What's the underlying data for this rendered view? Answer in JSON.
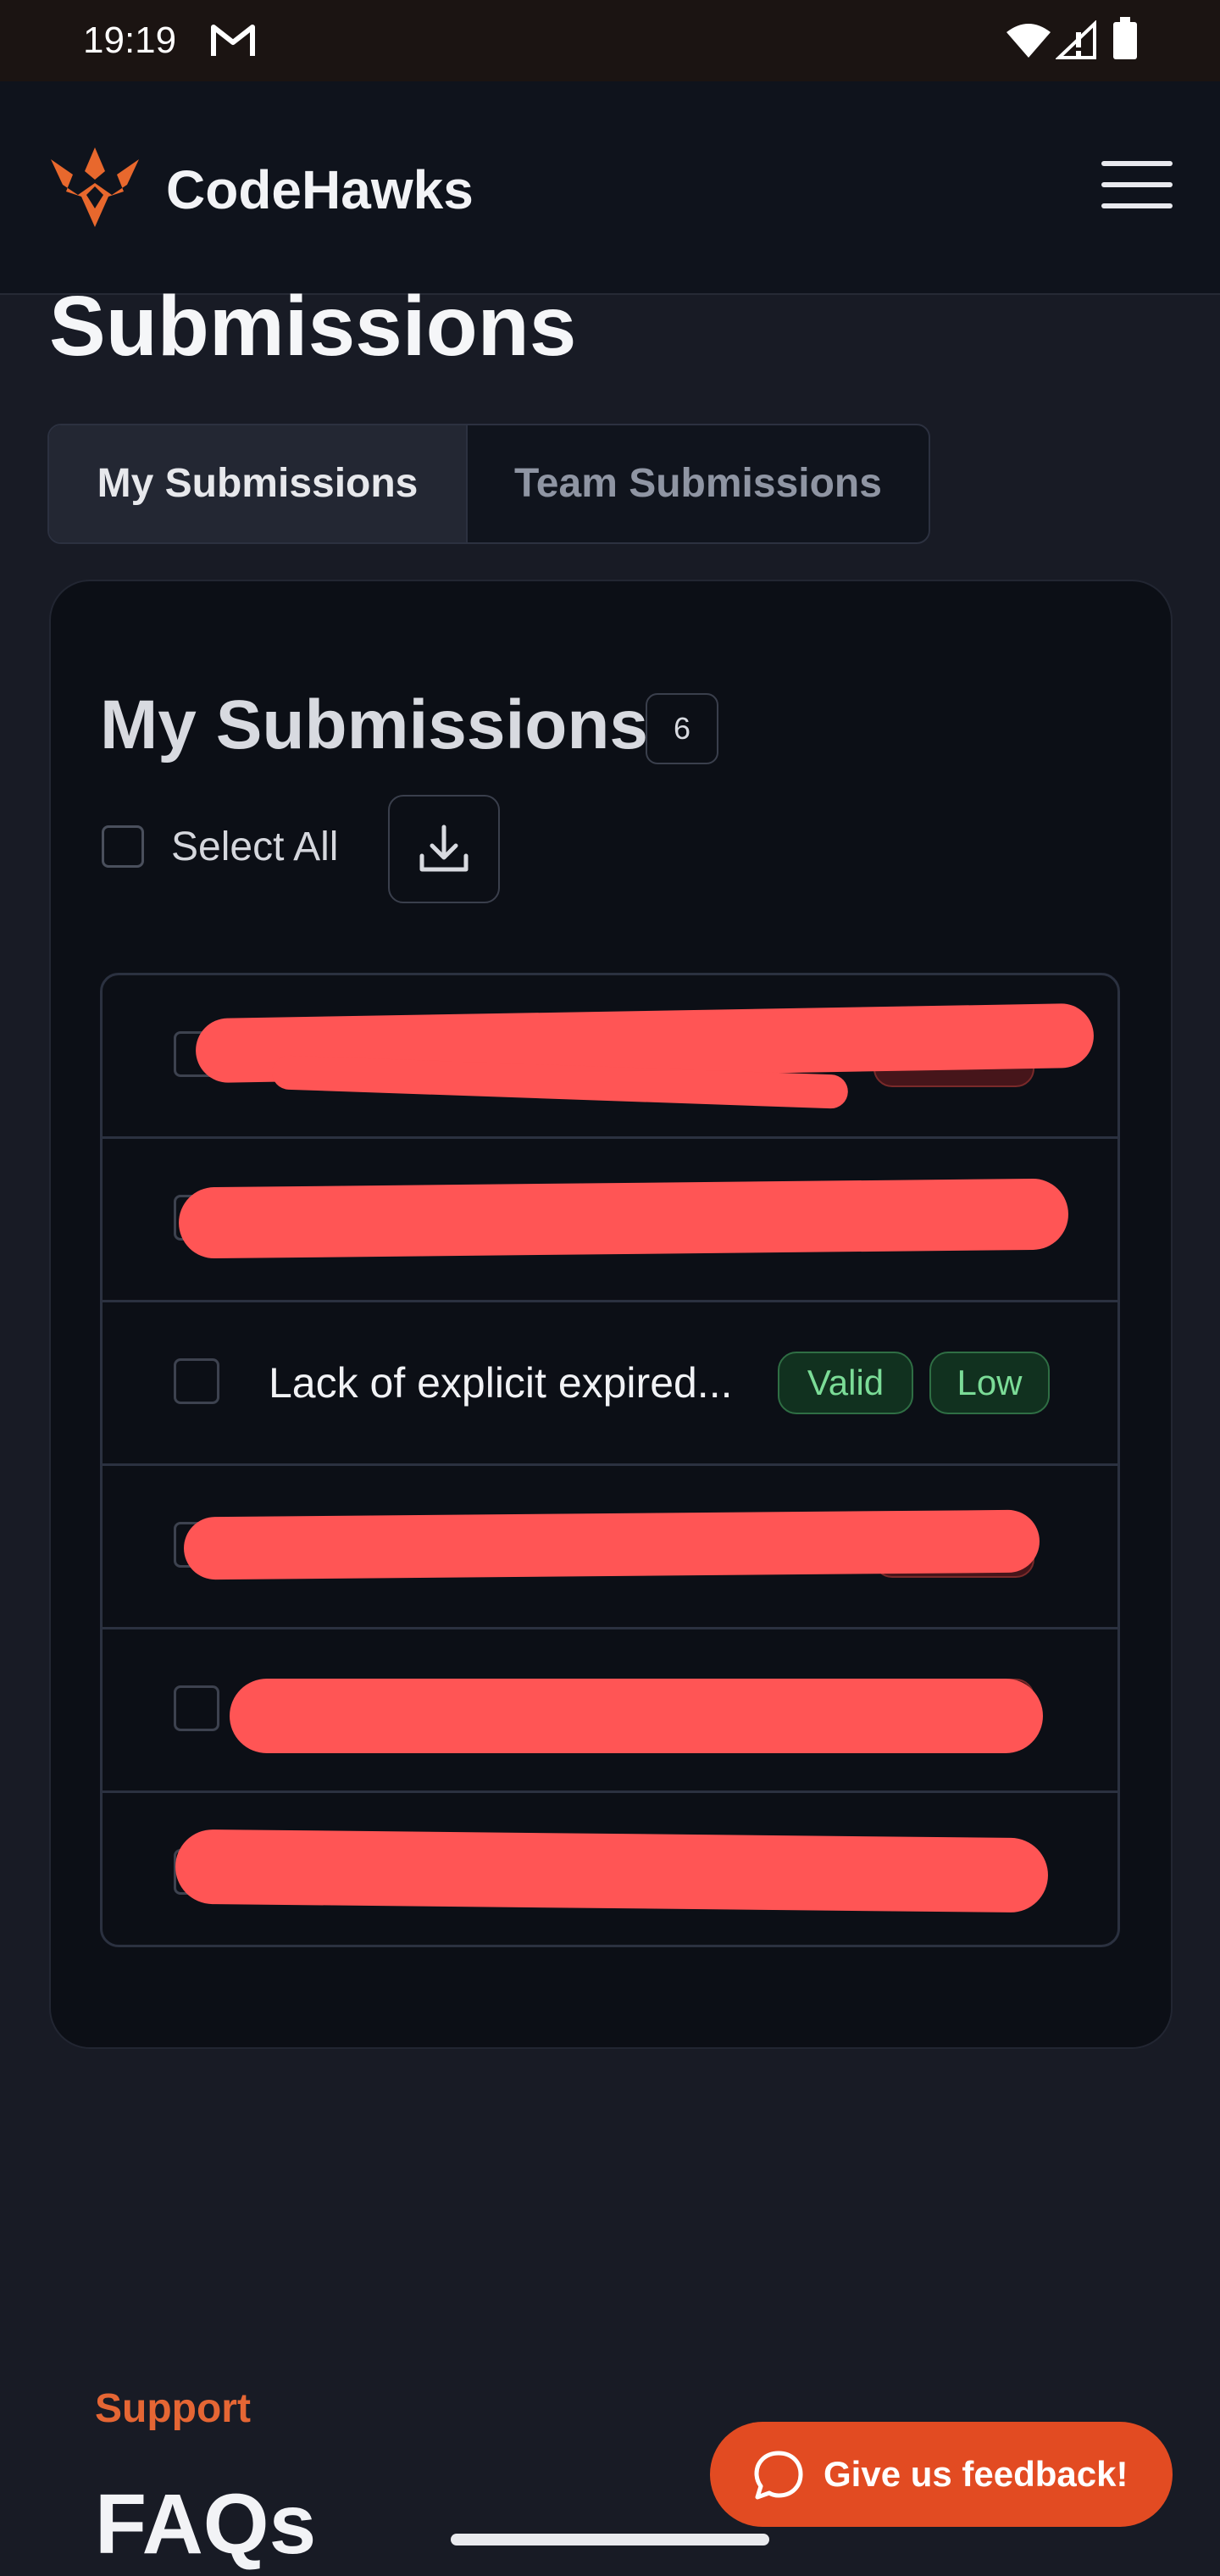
{
  "status_bar": {
    "time": "19:19",
    "mail_icon": "gmail-icon",
    "wifi_icon": "wifi-icon",
    "signal_icon": "signal-icon",
    "battery_icon": "battery-icon"
  },
  "nav": {
    "brand": "CodeHawks",
    "logo_icon": "hawk-logo-icon",
    "menu_icon": "hamburger-menu-icon",
    "accent_color": "#e8682d"
  },
  "page": {
    "title": "Submissions"
  },
  "tabs": [
    {
      "label": "My Submissions",
      "active": true
    },
    {
      "label": "Team Submissions",
      "active": false
    }
  ],
  "card": {
    "title": "My Submissions",
    "count": "6",
    "select_all_label": "Select All",
    "download_icon": "download-icon"
  },
  "submissions": [
    {
      "title": "",
      "status": "",
      "severity": "",
      "redacted": true
    },
    {
      "title": "",
      "status": "",
      "severity": "",
      "redacted": true
    },
    {
      "title": "Lack of explicit expired...",
      "status": "Valid",
      "severity": "Low",
      "redacted": false
    },
    {
      "title": "",
      "status": "",
      "severity": "",
      "redacted": true
    },
    {
      "title": "",
      "status": "",
      "severity": "",
      "redacted": true
    },
    {
      "title": "",
      "status": "",
      "severity": "",
      "redacted": true
    }
  ],
  "footer": {
    "support_label": "Support",
    "faq_title": "FAQs"
  },
  "feedback": {
    "label": "Give us feedback!",
    "icon": "chat-bubble-icon"
  },
  "colors": {
    "background": "#181b25",
    "nav_background": "#0f131c",
    "card_background": "#0c0f16",
    "valid_green": "#7bdc97",
    "invalid_red": "#46151a",
    "redaction": "#ff5555",
    "feedback_button": "#e24b22"
  }
}
